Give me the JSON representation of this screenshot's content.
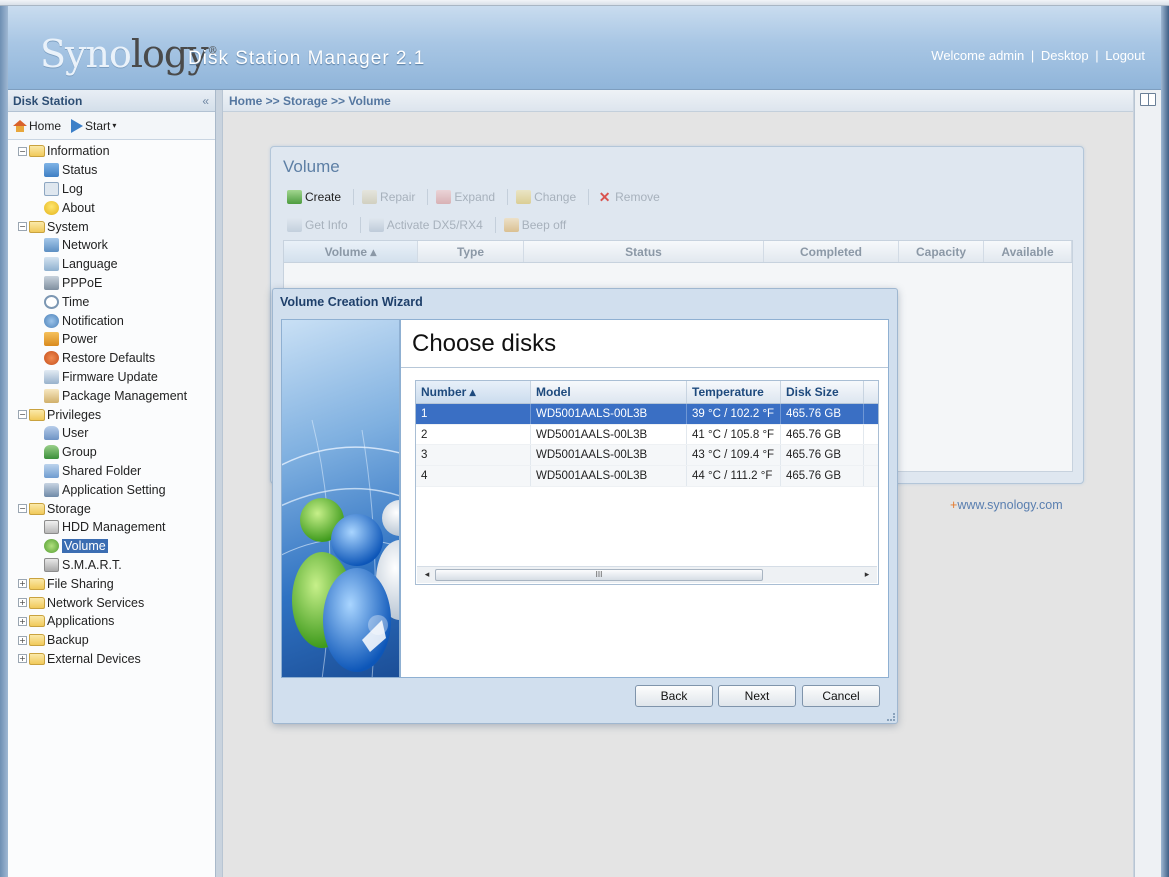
{
  "header": {
    "logo_syno": "Syno",
    "logo_logy": "logy",
    "logo_reg": "®",
    "product": "Disk Station Manager 2.1",
    "welcome": "Welcome admin",
    "desktop": "Desktop",
    "logout": "Logout",
    "separator": "|"
  },
  "left_panel": {
    "title": "Disk Station",
    "collapse_glyph": "«",
    "home": "Home",
    "start": "Start",
    "start_caret": "▾",
    "tree": {
      "information": "Information",
      "status": "Status",
      "log": "Log",
      "about": "About",
      "system": "System",
      "network": "Network",
      "language": "Language",
      "pppoe": "PPPoE",
      "time": "Time",
      "notification": "Notification",
      "power": "Power",
      "restore_defaults": "Restore Defaults",
      "firmware_update": "Firmware Update",
      "package_management": "Package Management",
      "privileges": "Privileges",
      "user": "User",
      "group": "Group",
      "shared_folder": "Shared Folder",
      "application_setting": "Application Setting",
      "storage": "Storage",
      "hdd_management": "HDD Management",
      "volume": "Volume",
      "smart": "S.M.A.R.T.",
      "file_sharing": "File Sharing",
      "network_services": "Network Services",
      "applications": "Applications",
      "backup": "Backup",
      "external_devices": "External Devices"
    },
    "expanded_glyph": "−",
    "collapsed_glyph": "+"
  },
  "breadcrumb": "Home >> Storage >> Volume",
  "volume_window": {
    "title": "Volume",
    "toolbar_row1": {
      "create": "Create",
      "repair": "Repair",
      "expand": "Expand",
      "change": "Change",
      "remove": "Remove",
      "remove_glyph": "✕"
    },
    "toolbar_row2": {
      "get_info": "Get Info",
      "activate": "Activate DX5/RX4",
      "beep_off": "Beep off"
    },
    "columns": {
      "volume": "Volume ▴",
      "type": "Type",
      "status": "Status",
      "completed": "Completed",
      "capacity": "Capacity",
      "available": "Available"
    }
  },
  "synology_link": {
    "plus": "+",
    "url": "www.synology.com"
  },
  "wizard": {
    "title": "Volume Creation Wizard",
    "heading": "Choose disks",
    "columns": {
      "number": "Number ▴",
      "model": "Model",
      "temperature": "Temperature",
      "disk_size": "Disk Size"
    },
    "disks": [
      {
        "number": "1",
        "model": "WD5001AALS-00L3B",
        "temperature": "39 °C / 102.2 °F",
        "size": "465.76 GB"
      },
      {
        "number": "2",
        "model": "WD5001AALS-00L3B",
        "temperature": "41 °C / 105.8 °F",
        "size": "465.76 GB"
      },
      {
        "number": "3",
        "model": "WD5001AALS-00L3B",
        "temperature": "43 °C / 109.4 °F",
        "size": "465.76 GB"
      },
      {
        "number": "4",
        "model": "WD5001AALS-00L3B",
        "temperature": "44 °C / 111.2 °F",
        "size": "465.76 GB"
      }
    ],
    "scroll_left": "◂",
    "scroll_right": "▸",
    "scroll_thumb": "III",
    "back": "Back",
    "next": "Next",
    "cancel": "Cancel"
  },
  "colors": {
    "header_blue": "#a8c6e4",
    "selection": "#3a6fc4",
    "accent_orange": "#e37a2e"
  }
}
